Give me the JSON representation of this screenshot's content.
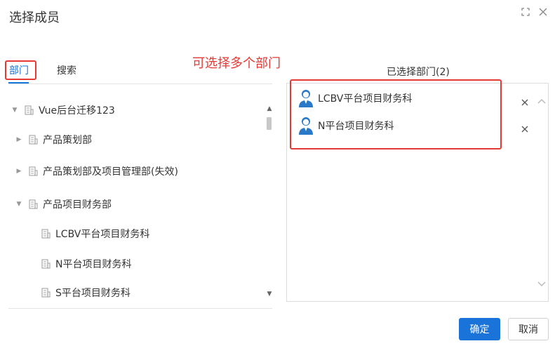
{
  "dialog": {
    "title": "选择成员"
  },
  "tabs": [
    {
      "label": "部门",
      "active": true
    },
    {
      "label": "搜索",
      "active": false
    }
  ],
  "annotation": "可选择多个部门",
  "tree": [
    {
      "label": "Vue后台迁移123",
      "caret": "expanded",
      "level": 0
    },
    {
      "label": "产品策划部",
      "caret": "collapsed",
      "level": 1
    },
    {
      "label": "产品策划部及项目管理部(失效)",
      "caret": "collapsed",
      "level": 1
    },
    {
      "label": "产品项目财务部",
      "caret": "expanded",
      "level": 1
    },
    {
      "label": "LCBV平台项目财务科",
      "caret": "none",
      "level": 2
    },
    {
      "label": "N平台项目财务科",
      "caret": "none",
      "level": 2
    },
    {
      "label": "S平台项目财务科",
      "caret": "none",
      "level": 2
    }
  ],
  "selected": {
    "title": "已选择部门(2)",
    "items": [
      {
        "label": "LCBV平台项目财务科"
      },
      {
        "label": "N平台项目财务科"
      }
    ]
  },
  "buttons": {
    "ok": "确定",
    "cancel": "取消"
  },
  "colors": {
    "primary": "#1a73d8",
    "annotation": "#e53935"
  }
}
